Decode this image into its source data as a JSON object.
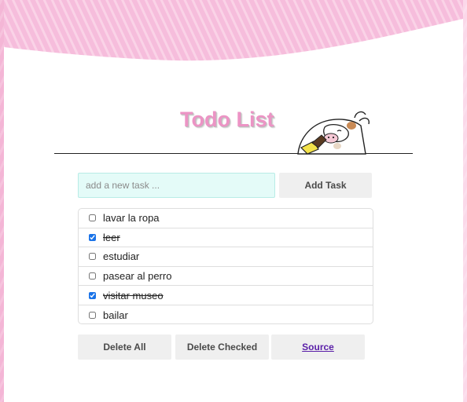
{
  "header": {
    "title": "Todo List"
  },
  "add_form": {
    "placeholder": "add a new task ...",
    "value": "",
    "add_label": "Add Task"
  },
  "tasks": [
    {
      "label": "lavar la ropa",
      "checked": false
    },
    {
      "label": "leer",
      "checked": true
    },
    {
      "label": "estudiar",
      "checked": false
    },
    {
      "label": "pasear al perro",
      "checked": false
    },
    {
      "label": "visitar museo",
      "checked": true
    },
    {
      "label": "bailar",
      "checked": false
    }
  ],
  "actions": {
    "delete_all_label": "Delete All",
    "delete_checked_label": "Delete Checked",
    "source_label": "Source"
  },
  "colors": {
    "background_pink": "#f4b6d6",
    "title_pink": "#ec94c5",
    "input_bg": "#e4fbf8",
    "button_bg": "#efefef",
    "link_purple": "#5a1fa8"
  },
  "icons": {
    "mascot": "cow-mascot-icon"
  }
}
